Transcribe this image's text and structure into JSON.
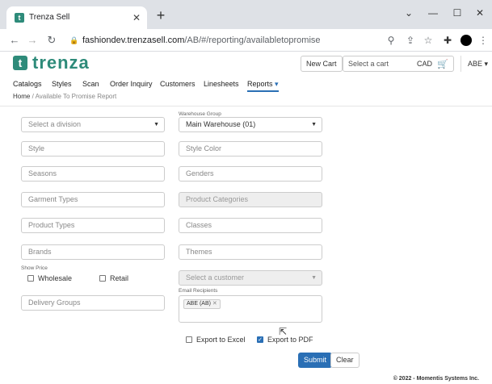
{
  "browser": {
    "tab_title": "Trenza Sell",
    "tab_close": "✕",
    "new_tab": "+",
    "url_host": "fashiondev.trenzasell.com",
    "url_path": "/AB/#/reporting/availabletopromise",
    "window_controls": [
      "⌄",
      "—",
      "☐",
      "✕"
    ]
  },
  "header": {
    "logo_mark": "t",
    "logo_text": "trenza",
    "new_cart": "New Cart",
    "cart_placeholder": "Select a cart",
    "currency": "CAD",
    "user": "ABE"
  },
  "nav": {
    "items": [
      "Catalogs",
      "Styles",
      "Scan",
      "Order Inquiry",
      "Customers",
      "Linesheets",
      "Reports"
    ]
  },
  "breadcrumb": {
    "home": "Home",
    "separator": "/",
    "current": "Available To Promise Report"
  },
  "form": {
    "division_placeholder": "Select a division",
    "warehouse_group_label": "Warehouse Group",
    "warehouse_group_value": "Main Warehouse (01)",
    "style": "Style",
    "style_color": "Style Color",
    "seasons": "Seasons",
    "genders": "Genders",
    "garment_types": "Garment Types",
    "product_categories": "Product Categories",
    "product_types": "Product Types",
    "classes": "Classes",
    "brands": "Brands",
    "themes": "Themes",
    "show_price_label": "Show Price",
    "wholesale": "Wholesale",
    "retail": "Retail",
    "customer_placeholder": "Select a customer",
    "email_recipients_label": "Email Recipients",
    "email_tag": "ABE (AB)",
    "delivery_groups": "Delivery Groups",
    "export_excel": "Export to Excel",
    "export_pdf": "Export to PDF",
    "export_excel_checked": false,
    "export_pdf_checked": true,
    "submit": "Submit",
    "clear": "Clear"
  },
  "footer": {
    "copyright": "© 2022 - Momentis Systems Inc."
  },
  "colors": {
    "brand": "#2e8b7a",
    "primary": "#2a6fb5"
  }
}
